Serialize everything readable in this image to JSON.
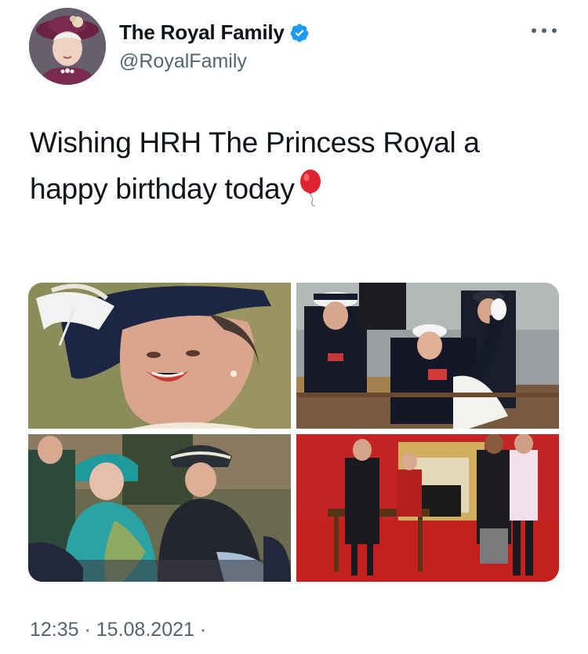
{
  "author": {
    "display_name": "The Royal Family",
    "handle": "@RoyalFamily",
    "verified": true
  },
  "tweet": {
    "text": "Wishing HRH The Princess Royal a happy birthday today",
    "emoji": "balloon-emoji"
  },
  "media": [
    {
      "name": "photo-princess-portrait"
    },
    {
      "name": "photo-princess-on-boat-waving"
    },
    {
      "name": "photo-queen-and-princess-seated"
    },
    {
      "name": "photo-princess-investiture-ceremony"
    }
  ],
  "meta": {
    "timestamp": "12:35 · 15.08.2021 ·"
  },
  "colors": {
    "verified_blue": "#1d9bf0",
    "secondary_text": "#536471",
    "primary_text": "#0f1419",
    "balloon_red": "#e0242f"
  }
}
